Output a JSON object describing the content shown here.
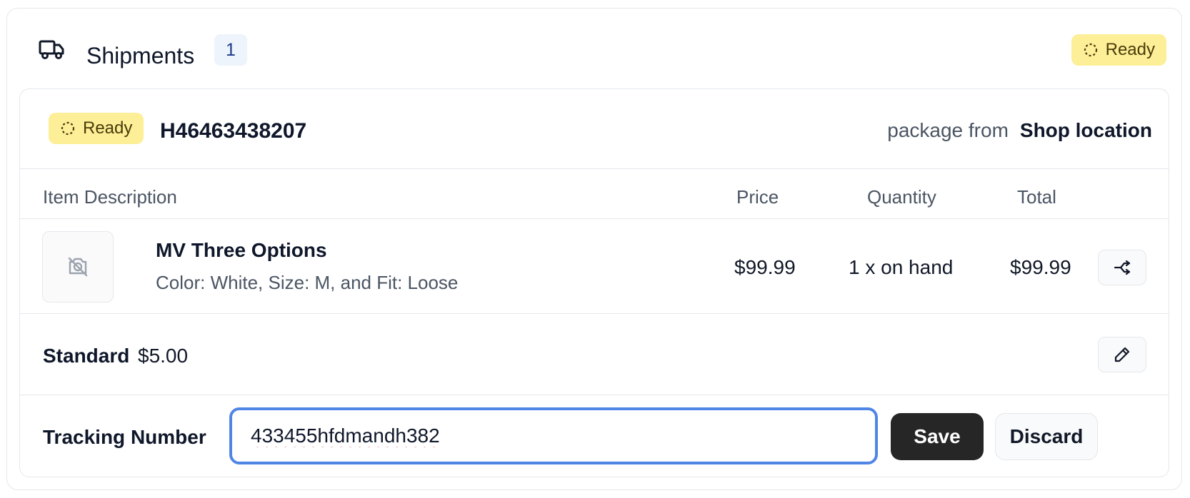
{
  "header": {
    "title": "Shipments",
    "count": "1",
    "status": "Ready"
  },
  "package": {
    "status": "Ready",
    "id": "H46463438207",
    "from_label": "package from",
    "from_location": "Shop location"
  },
  "table": {
    "headers": {
      "description": "Item Description",
      "price": "Price",
      "quantity": "Quantity",
      "total": "Total"
    },
    "items": [
      {
        "name": "MV Three Options",
        "variant": "Color: White, Size: M, and Fit: Loose",
        "price": "$99.99",
        "quantity": "1 x on hand",
        "total": "$99.99",
        "image": "no-image-icon"
      }
    ]
  },
  "shipping": {
    "method": "Standard",
    "price": "$5.00"
  },
  "tracking": {
    "label": "Tracking Number",
    "value": "433455hfdmandh382",
    "save_label": "Save",
    "discard_label": "Discard"
  },
  "icons": {
    "header": "truck-icon",
    "status": "loader-circle-icon",
    "item_action": "split-icon",
    "shipping_action": "pencil-icon"
  },
  "colors": {
    "status_bg": "#fcef97",
    "focus_ring": "#4f86e6",
    "primary_button": "#262626"
  }
}
